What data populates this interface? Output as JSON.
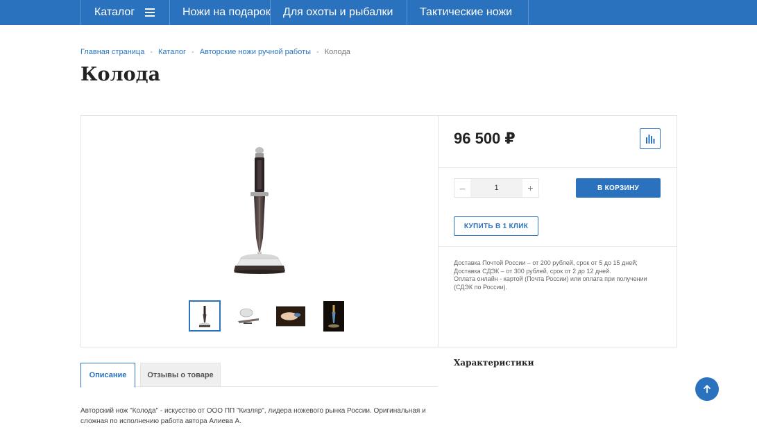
{
  "nav": {
    "catalog": "Каталог",
    "items": [
      "Ножи на подарок",
      "Для охоты и рыбалки",
      "Тактические ножи"
    ]
  },
  "breadcrumb": {
    "home": "Главная страница",
    "catalog": "Каталог",
    "section": "Авторские ножи ручной работы",
    "current": "Колода",
    "separator": "-"
  },
  "product": {
    "title": "Колода",
    "price": "96 500 ₽",
    "quantity": "1",
    "minus": "–",
    "plus": "+",
    "add_to_cart": "В КОРЗИНУ",
    "buy_one_click": "КУПИТЬ В 1 КЛИК",
    "delivery_lines": [
      "Доставка Почтой России – от 200 рублей, срок от 5 до 15 дней;",
      "Доставка СДЭК – от 300 рублей, срок от 2 до 12 дней.",
      "Оплата онлайн - картой (Почта России) или оплата при получении (СДЭК по России)."
    ]
  },
  "tabs": {
    "description": "Описание",
    "reviews": "Отзывы о товаре"
  },
  "characteristics_title": "Характеристики",
  "description_text": "Авторский нож \"Колода\" - искусство от ООО ПП \"Кизляр\", лидера ножевого рынка России. Оригинальная и сложная по исполнению работа автора Алиева А.",
  "colors": {
    "brand": "#2a72bd"
  }
}
